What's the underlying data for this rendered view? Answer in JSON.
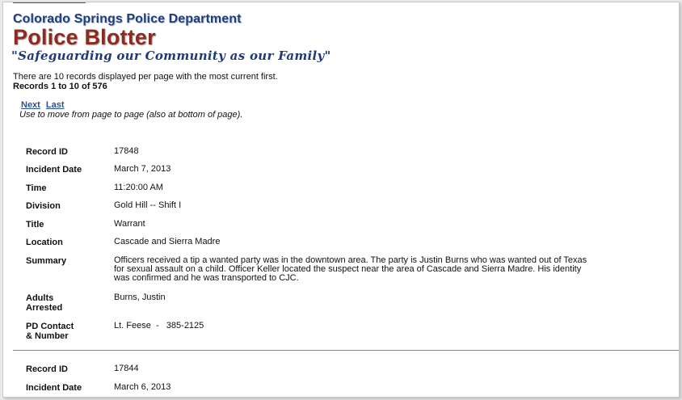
{
  "header": {
    "department": "Colorado Springs Police Department",
    "title": "Police Blotter",
    "motto": "\"Safeguarding our Community as our Family\""
  },
  "intro": {
    "line1": "There are 10 records displayed per page with the most current first.",
    "line2": "Records 1 to 10 of 576"
  },
  "nav": {
    "next": "Next",
    "last": "Last",
    "hint": "Use to move from page to page (also at bottom of page)."
  },
  "labels": {
    "record_id": "Record ID",
    "incident_date": "Incident Date",
    "time": "Time",
    "division": "Division",
    "title": "Title",
    "location": "Location",
    "summary": "Summary",
    "adults_arrested_1": "Adults",
    "adults_arrested_2": "Arrested",
    "pd_contact_1": "PD Contact",
    "pd_contact_2": "& Number"
  },
  "records": [
    {
      "record_id": "17848",
      "incident_date": "March 7, 2013",
      "time": "11:20:00 AM",
      "division": "Gold Hill -- Shift I",
      "title": "Warrant",
      "location": "Cascade and Sierra Madre",
      "summary_1": "Officers received a tip a wanted party was in the downtown area. The party is Justin Burns who was wanted out of Texas",
      "summary_2": "for sexual assault on a child. Officer Keller located the suspect near the area of Cascade and Sierra Madre. His identity",
      "summary_3": "was confirmed and he was transported to CJC.",
      "adults_arrested": "Burns, Justin",
      "pd_contact": "Lt. Feese  -   385-2125"
    },
    {
      "record_id": "17844",
      "incident_date": "March 6, 2013"
    }
  ]
}
